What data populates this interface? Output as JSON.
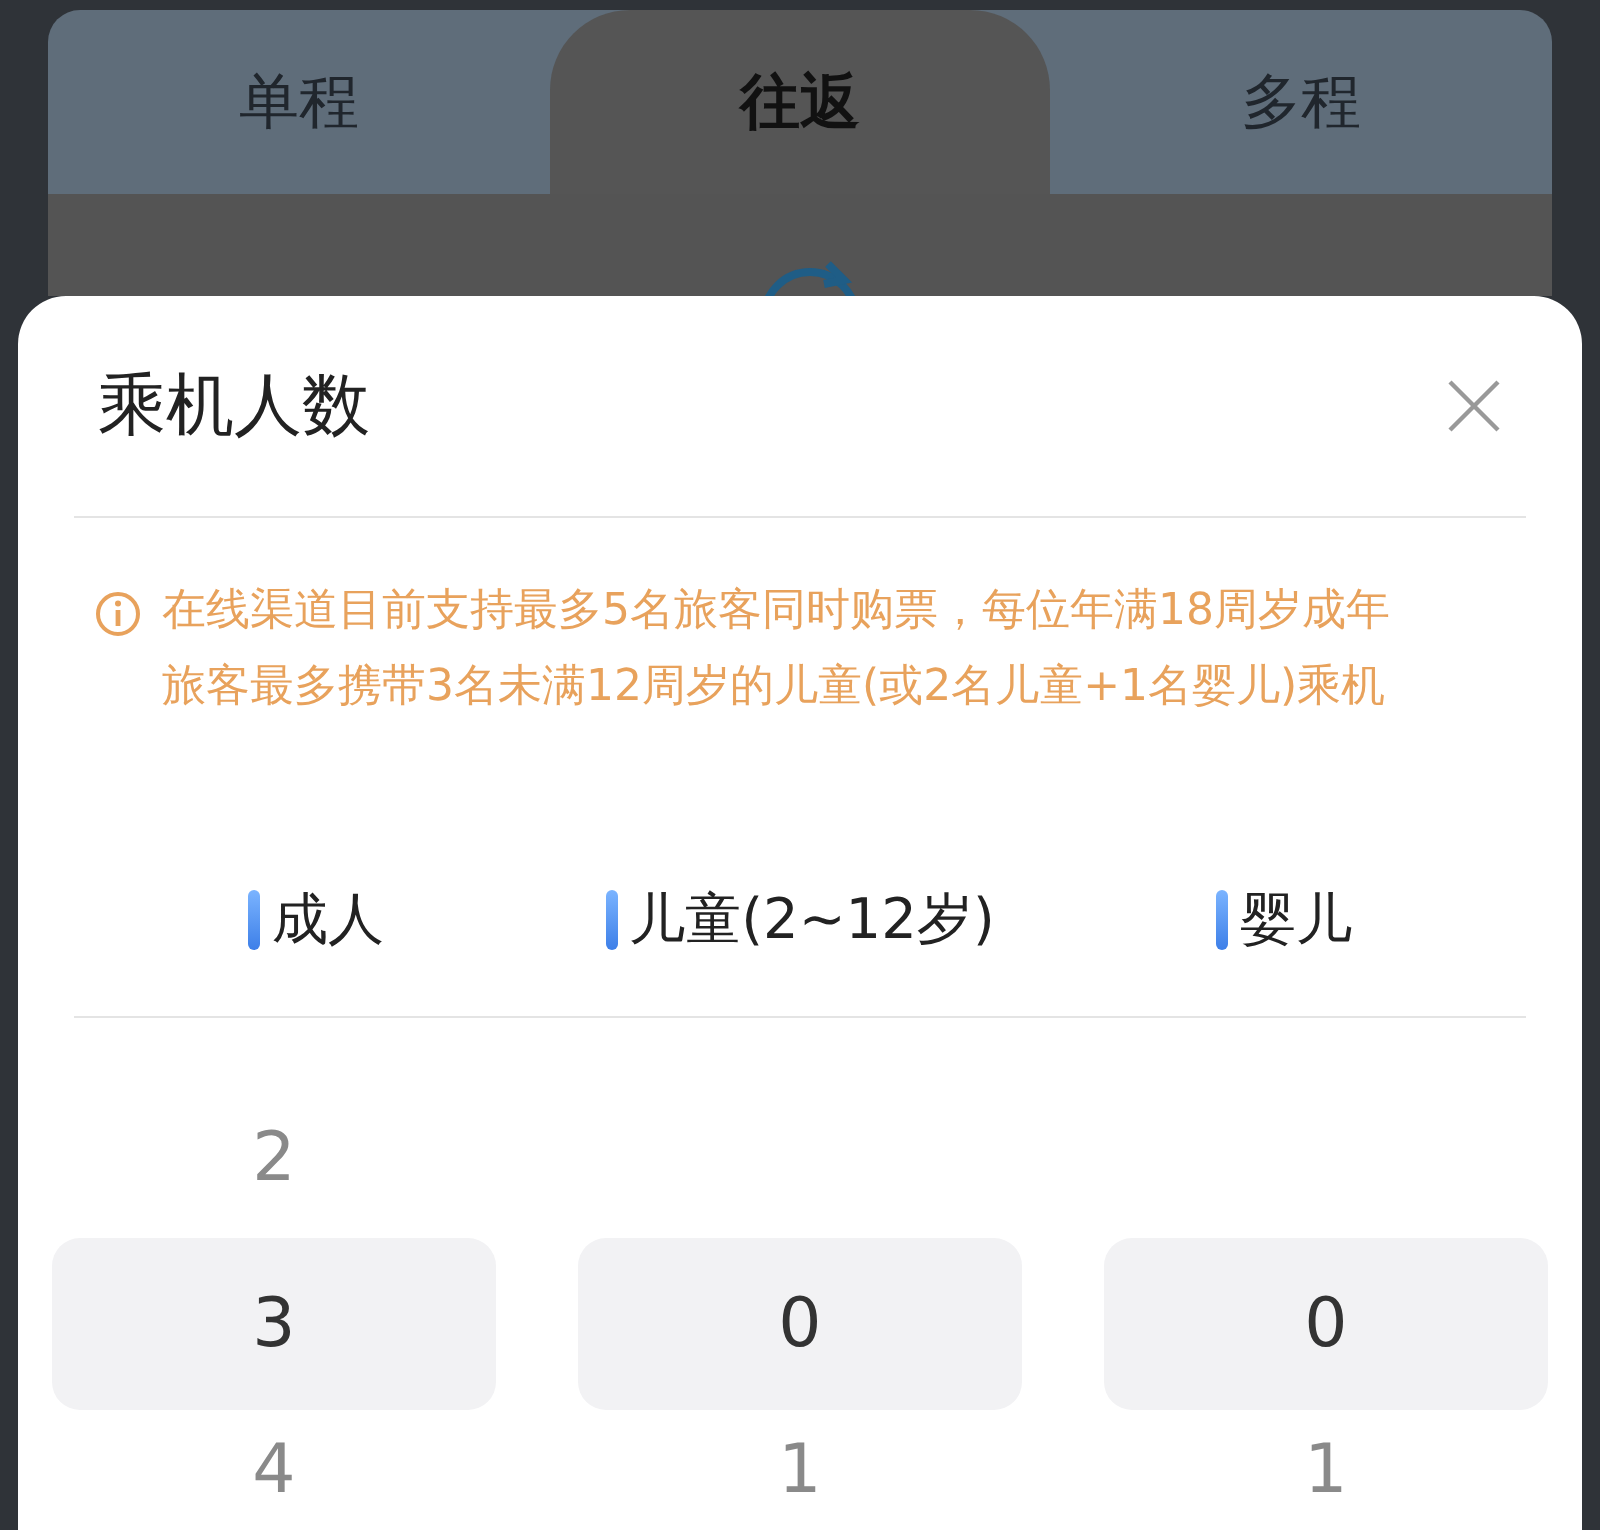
{
  "trip_tabs": [
    {
      "label": "单程",
      "selected": false
    },
    {
      "label": "往返",
      "selected": true
    },
    {
      "label": "多程",
      "selected": false
    }
  ],
  "sheet": {
    "title": "乘机人数",
    "notice": "在线渠道目前支持最多5名旅客同时购票，每位年满18周岁成年旅客最多携带3名未满12周岁的儿童(或2名儿童+1名婴儿)乘机",
    "columns": [
      {
        "label": "成人",
        "options": [
          {
            "value": "2",
            "selected": false
          },
          {
            "value": "3",
            "selected": true
          },
          {
            "value": "4",
            "selected": false
          }
        ]
      },
      {
        "label": "儿童(2~12岁)",
        "options": [
          {
            "value": "0",
            "selected": true
          },
          {
            "value": "1",
            "selected": false
          }
        ]
      },
      {
        "label": "婴儿",
        "options": [
          {
            "value": "0",
            "selected": true
          },
          {
            "value": "1",
            "selected": false
          }
        ]
      }
    ]
  }
}
